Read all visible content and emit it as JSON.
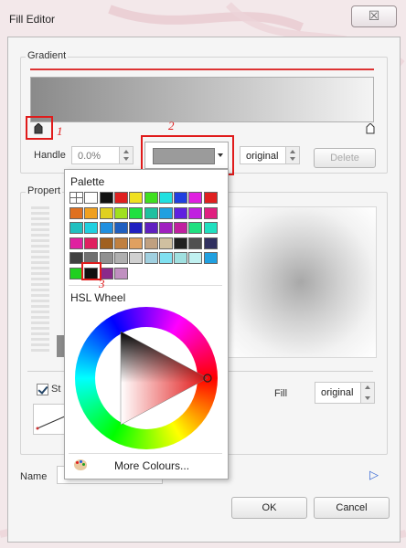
{
  "window": {
    "title": "Fill Editor",
    "close_glyph": "☒"
  },
  "gradient": {
    "group_label": "Gradient",
    "handle_label": "Handle",
    "handle_value": "0.0%",
    "blend_value": "original",
    "delete_label": "Delete"
  },
  "properties": {
    "group_label": "Propert",
    "stroke_label": "St",
    "fill_label": "Fill",
    "fill_value": "original"
  },
  "annotations": {
    "n1": "1",
    "n2": "2",
    "n3": "3"
  },
  "popup": {
    "palette_label": "Palette",
    "hsl_label": "HSL Wheel",
    "more_colours_label": "More Colours...",
    "palette_rows": [
      [
        "#ffffff",
        "#ffffff",
        "#111111",
        "#e02020",
        "#f0e020",
        "#40e020",
        "#20e0e0",
        "#2040e0",
        "#e020e0",
        "#e02020"
      ],
      [
        "#e07020",
        "#f0a020",
        "#e0d020",
        "#a0e020",
        "#20e040",
        "#20c0a0",
        "#20a0e0",
        "#6020e0",
        "#c020e0",
        "#e02080"
      ],
      [
        "#20c0c0",
        "#20d0e0",
        "#2090e0",
        "#2060c0",
        "#2020c0",
        "#6020c0",
        "#a020c0",
        "#c020a0",
        "#20e080",
        "#20e0c0"
      ],
      [
        "#e020a0",
        "#e02060",
        "#a06020",
        "#c08040",
        "#e0a060",
        "#c0a080",
        "#d0c0a0",
        "#202020",
        "#505050",
        "#303060"
      ],
      [
        "#404040",
        "#707070",
        "#909090",
        "#b0b0b0",
        "#d0d0d0",
        "#a0d0e0",
        "#80e0f0",
        "#a0e0e0",
        "#c0f0f0",
        "#20a0e0"
      ],
      [
        "#20d020",
        "#101010",
        "#8a2a8a",
        "#c090c0"
      ]
    ]
  },
  "footer": {
    "name_label": "Name",
    "ok_label": "OK",
    "cancel_label": "Cancel",
    "play_glyph": "▷"
  },
  "colors": {
    "annotation_red": "#e01b1b",
    "gradient_line": "#d33333",
    "selected_swatch": "#9b9b9b"
  }
}
